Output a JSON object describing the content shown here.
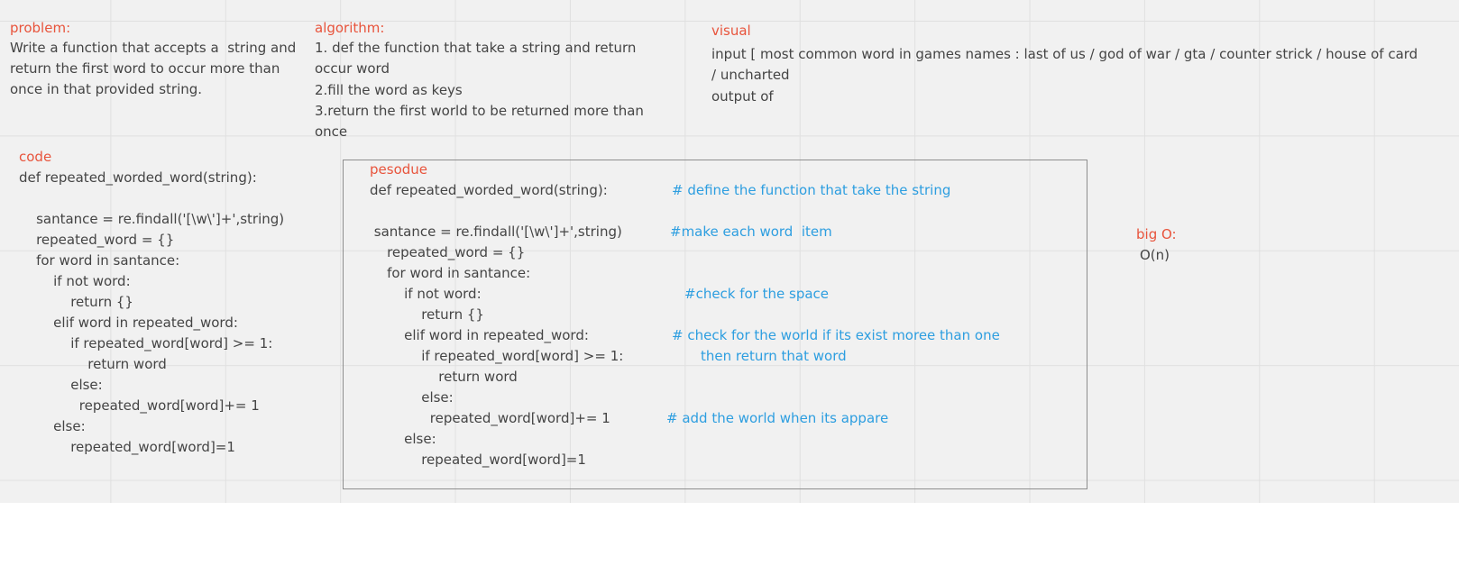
{
  "colors": {
    "heading": "#e8543c",
    "comment": "#2d9ee0",
    "text": "#444444",
    "canvas": "#f1f1f1",
    "grid": "#e0e0e0",
    "frame": "#8e8e8e"
  },
  "problem": {
    "heading": "problem:",
    "lines": [
      "Write a function that accepts a  string and",
      "return the first word to occur more than",
      "once in that provided string."
    ]
  },
  "algorithm": {
    "heading": "algorithm:",
    "lines": [
      "1. def the function that take a string and return",
      "occur word",
      "2.fill the word as keys",
      "3.return the first world to be returned more than",
      "once"
    ]
  },
  "visual": {
    "heading": "visual",
    "lines": [
      "input [ most common word in games names : last of us / god of war / gta / counter strick / house of card",
      "/ uncharted",
      "output of"
    ]
  },
  "code": {
    "heading": "code",
    "lines": [
      "def repeated_worded_word(string):",
      "",
      "    santance = re.findall('[\\w\\']+',string)",
      "    repeated_word = {}",
      "    for word in santance:",
      "        if not word:",
      "            return {}",
      "        elif word in repeated_word:",
      "            if repeated_word[word] >= 1:",
      "                return word",
      "            else:",
      "              repeated_word[word]+= 1",
      "        else:",
      "            repeated_word[word]=1"
    ]
  },
  "pseudocode": {
    "heading": "pesodue",
    "lines": [
      "def repeated_worded_word(string):",
      "",
      " santance = re.findall('[\\w\\']+',string)",
      "    repeated_word = {}",
      "    for word in santance:",
      "        if not word:",
      "            return {}",
      "        elif word in repeated_word:",
      "            if repeated_word[word] >= 1:",
      "                return word",
      "            else:",
      "              repeated_word[word]+= 1",
      "        else:",
      "            repeated_word[word]=1"
    ],
    "comments": [
      "# define the function that take the string",
      "#make each word  item",
      "#check for the space",
      "# check for the world if its exist moree than one",
      "then return that word",
      "# add the world when its appare"
    ]
  },
  "big_o": {
    "heading": "big O:",
    "value": "O(n)"
  }
}
